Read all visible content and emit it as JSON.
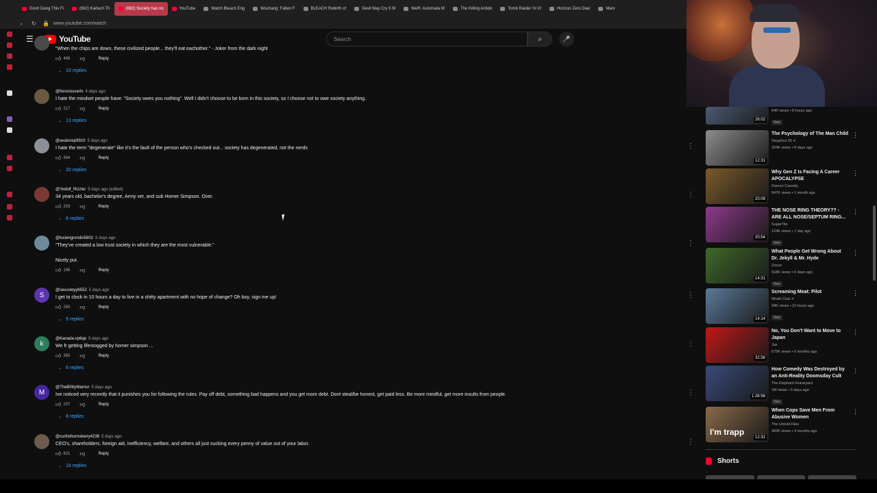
{
  "tabs": [
    {
      "label": "Gosh Dang This Fi",
      "icon": "youtube-icon"
    },
    {
      "label": "(682) Karlach Th",
      "icon": "youtube-icon"
    },
    {
      "label": "(682) Society has no",
      "icon": "youtube-icon",
      "active": true
    },
    {
      "label": "YouTube",
      "icon": "youtube-icon"
    },
    {
      "label": "Watch Bleach Eng",
      "icon": "web-icon"
    },
    {
      "label": "Wuchang: Fallen F",
      "icon": "web-icon"
    },
    {
      "label": "BLEACH Rebirth of",
      "icon": "web-icon"
    },
    {
      "label": "Devil May Cry 5 M",
      "icon": "web-icon"
    },
    {
      "label": "NieR: Automata M",
      "icon": "web-icon"
    },
    {
      "label": "The Killing Antido",
      "icon": "web-icon"
    },
    {
      "label": "Tomb Raider IV-VI",
      "icon": "web-icon"
    },
    {
      "label": "Horizon Zero Daw",
      "icon": "web-icon"
    },
    {
      "label": "Marv",
      "icon": "web-icon"
    }
  ],
  "address": {
    "url": "www.youtube.com/watch"
  },
  "masthead": {
    "logo": "YouTube",
    "search_placeholder": "Search"
  },
  "comments": [
    {
      "author": "",
      "time": "",
      "text": "\"When the chips are down, these civilized people... they'll eat eachother.\" - Joker from the dark night",
      "text2": "",
      "likes": "466",
      "reply": "Reply",
      "replies": "10 replies",
      "avatar_letter": "",
      "avatar_color": "#4a4a4a"
    },
    {
      "author": "@furociousarts",
      "time": "4 days ago",
      "text": "I hate the mindset people have: \"Society owes you nothing\". Well I didn't choose to be born in this society, so I choose not to owe society anything.",
      "text2": "",
      "likes": "217",
      "reply": "Reply",
      "replies": "13 replies",
      "avatar_letter": "",
      "avatar_color": "#6b5a3e"
    },
    {
      "author": "@avalsnep9910",
      "time": "5 days ago",
      "text": "I hate the term \"degenerate\" like it's the fault of the person who's checked out... society has degenerated, not the nerds",
      "text2": "",
      "likes": "384",
      "reply": "Reply",
      "replies": "20 replies",
      "avatar_letter": "",
      "avatar_color": "#8a8f98"
    },
    {
      "author": "@Yedolf_Rizzler",
      "time": "5 days ago (edited)",
      "text": "34 years old, bachelor's degree, Army vet, and sub Homer Simpson. Over.",
      "text2": "",
      "likes": "203",
      "reply": "Reply",
      "replies": "8 replies",
      "avatar_letter": "",
      "avatar_color": "#7a3a32"
    },
    {
      "author": "@luciengrondin5802",
      "time": "5 days ago",
      "text": "\"They've created a low trust society in which they are the most vulnerable.\"",
      "text2": "Nicely put.",
      "likes": "196",
      "reply": "Reply",
      "replies": "",
      "avatar_letter": "",
      "avatar_color": "#6c8a9a"
    },
    {
      "author": "@sevusleyy6552",
      "time": "5 days ago",
      "text": "I get to clock in 10 hours a day to live in a shitty apartment with no hope of change? Oh boy, sign me up!",
      "text2": "",
      "likes": "260",
      "reply": "Reply",
      "replies": "9 replies",
      "avatar_letter": "S",
      "avatar_color": "#5e35b1"
    },
    {
      "author": "@Kanada-vp6qe",
      "time": "5 days ago",
      "text": "We fr getting lifemogged by homer simpson ...",
      "text2": "",
      "likes": "365",
      "reply": "Reply",
      "replies": "6 replies",
      "avatar_letter": "k",
      "avatar_color": "#2e7d5b"
    },
    {
      "author": "@TheB0ttyWarrior",
      "time": "5 days ago",
      "text": "Ive noticed very recently that it punishes you for following the rules. Pay off debt, something bad happens and you get more debt. Dont steal/be honest, get paid less. Be more mindful, get more insults from people.",
      "text2": "",
      "likes": "207",
      "reply": "Reply",
      "replies": "8 replies",
      "avatar_letter": "M",
      "avatar_color": "#4527a0"
    },
    {
      "author": "@curtisthornsberry4236",
      "time": "5 days ago",
      "text": "CEO's, shareholders, foreign aid, inefficiency, welfare, and others all just sucking every penny of value out of your labor.",
      "text2": "",
      "likes": "621",
      "reply": "Reply",
      "replies": "16 replies",
      "avatar_letter": "",
      "avatar_color": "#6e5b4d"
    }
  ],
  "sidebar": [
    {
      "title": "",
      "channel": "",
      "meta": "64K views • 8 hours ago",
      "new": "New",
      "duration": "26:02",
      "thumb": "#4b5a72"
    },
    {
      "title": "The Psychology of The Man Child",
      "channel": "Sisyphus 55 ✔",
      "meta": "324K views • 8 days ago",
      "new": "",
      "duration": "12:31",
      "thumb": "#8c8c8c"
    },
    {
      "title": "Why Gen Z Is Facing A Career APOCALYPSE",
      "channel": "Damon Cassidy",
      "meta": "647K views • 1 month ago",
      "new": "",
      "duration": "20:09",
      "thumb": "#7a5a2a"
    },
    {
      "title": "THE NOSE RING THEORY?? - ARE ALL NOSE/SEPTUM RING...",
      "channel": "SugarTits",
      "meta": "124K views • 1 day ago",
      "new": "New",
      "duration": "20:54",
      "thumb": "#8e3a8a"
    },
    {
      "title": "What People Get Wrong About Dr. Jekyll & Mr. Hyde",
      "channel": "Zoose",
      "meta": "518K views • 6 days ago",
      "new": "New",
      "duration": "14:31",
      "thumb": "#3f6a2a"
    },
    {
      "title": "Screaming Meat: Pilot",
      "channel": "Wrath Club ✔",
      "meta": "34K views • 15 hours ago",
      "new": "New",
      "duration": "14:14",
      "thumb": "#5a7a9a"
    },
    {
      "title": "No, You Don't Want to Move to Japan",
      "channel": "Jax",
      "meta": "675K views • 6 months ago",
      "new": "",
      "duration": "32:56",
      "thumb": "#c01818"
    },
    {
      "title": "How Comedy Was Destroyed by an Anti-Reality Doomsday Cult",
      "channel": "The Elephant Graveyard",
      "meta": "1M views • 5 days ago",
      "new": "New",
      "duration": "1:28:56",
      "thumb": "#3a4a7a"
    },
    {
      "title": "When Cops Save Men From Abusive Women",
      "channel": "The Untold Files",
      "meta": "492K views • 3 months ago",
      "new": "",
      "duration": "12:31",
      "thumb": "#8a6a4a",
      "overlay": "I'm trapp"
    }
  ],
  "shorts": {
    "label": "Shorts"
  }
}
